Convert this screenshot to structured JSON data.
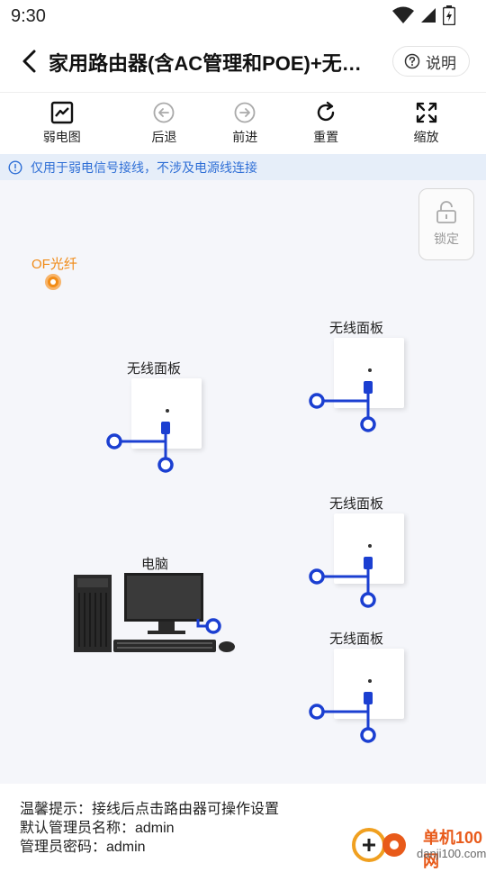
{
  "status": {
    "time": "9:30"
  },
  "header": {
    "title": "家用路由器(含AC管理和POE)+无…",
    "help_label": "说明"
  },
  "toolbar": {
    "items": [
      {
        "label": "弱电图",
        "icon": "chart-icon"
      },
      {
        "label": "后退",
        "icon": "arrow-left-circle-icon"
      },
      {
        "label": "前进",
        "icon": "arrow-right-circle-icon"
      },
      {
        "label": "重置",
        "icon": "refresh-icon"
      },
      {
        "label": "缩放",
        "icon": "expand-arrows-icon"
      }
    ]
  },
  "notice": {
    "text": "仅用于弱电信号接线，不涉及电源线连接"
  },
  "canvas": {
    "lock_label": "锁定",
    "fiber_label": "OF光纤",
    "devices": [
      {
        "label": "无线面板"
      },
      {
        "label": "无线面板"
      },
      {
        "label": "电脑"
      },
      {
        "label": "无线面板"
      },
      {
        "label": "无线面板"
      }
    ]
  },
  "footer": {
    "line1": "温馨提示：接线后点击路由器可操作设置",
    "line2": "默认管理员名称：admin",
    "line3": "管理员密码：admin"
  },
  "watermark": {
    "text1": "单机100网",
    "text2": "danji100.com"
  },
  "colors": {
    "accent": "#2f6fd6",
    "wire": "#1b3fd1",
    "fiber": "#f28c16",
    "notice_bg": "#e6eef9"
  }
}
